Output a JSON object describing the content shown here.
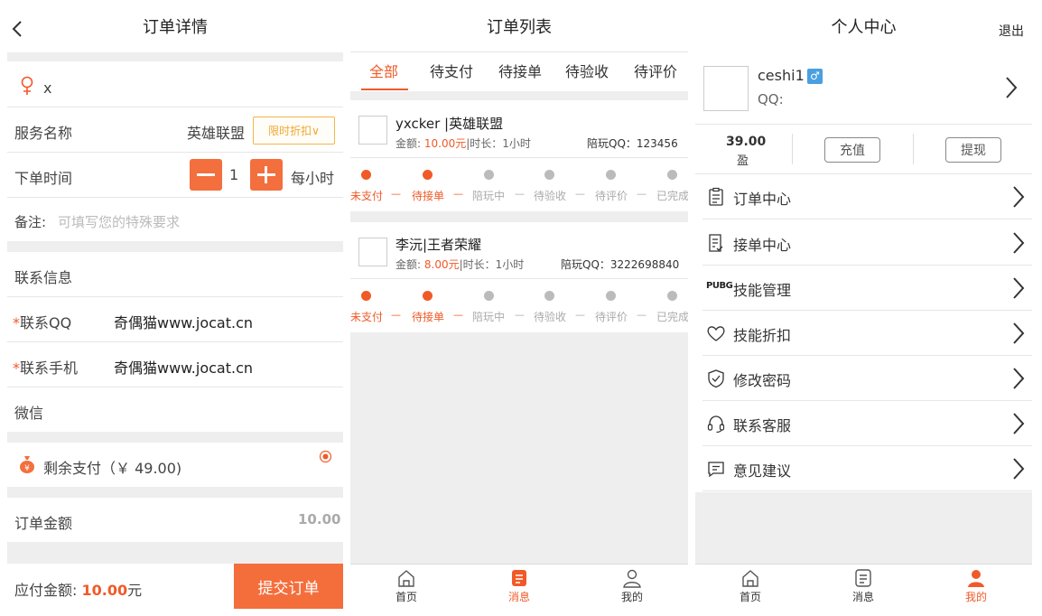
{
  "order_detail": {
    "title": "订单详情",
    "gender_name": "x",
    "service_label": "服务名称",
    "service_value": "英雄联盟",
    "promo_label": "限时折扣∨",
    "time_label": "下单时间",
    "quantity": "1",
    "unit": "每小时",
    "remark_label": "备注:",
    "remark_placeholder": "可填写您的特殊要求",
    "contact_title": "联系信息",
    "qq_label": "联系QQ",
    "qq_value": "奇偶猫www.jocat.cn",
    "phone_label": "联系手机",
    "phone_value": "奇偶猫www.jocat.cn",
    "wechat_label": "微信",
    "required_mark": "*",
    "pay_option": "剩余支付（￥ 49.00)",
    "amount_label": "订单金额",
    "amount_value": "10.00",
    "payable_label": "应付金额:",
    "payable_value": "10.00",
    "payable_unit": "元",
    "submit_label": "提交订单"
  },
  "order_list": {
    "title": "订单列表",
    "tabs": [
      "全部",
      "待支付",
      "待接单",
      "待验收",
      "待评价"
    ],
    "active_tab": "全部",
    "orders": [
      {
        "name": "yxcker |英雄联盟",
        "amount_label": "金额:",
        "amount": "10.00元",
        "duration": "|时长：1小时",
        "qq": "陪玩QQ：123456"
      },
      {
        "name": "李沅|王者荣耀",
        "amount_label": "金额:",
        "amount": "8.00元",
        "duration": "|时长：1小时",
        "qq": "陪玩QQ：3222698840"
      }
    ],
    "steps": [
      "未支付",
      "待接单",
      "陪玩中",
      "待验收",
      "待评价",
      "已完成"
    ],
    "steps_done": 2
  },
  "profile": {
    "title": "个人中心",
    "logout": "退出",
    "username": "ceshi1",
    "gender_symbol": "♂",
    "qq_label": "QQ:",
    "balance": "39.00",
    "balance_label": "盈",
    "recharge": "充值",
    "withdraw": "提现",
    "menu": [
      {
        "label": "订单中心",
        "icon": "clipboard-icon"
      },
      {
        "label": "接单中心",
        "icon": "checklist-icon"
      },
      {
        "label": "技能管理",
        "icon": "pubg-icon"
      },
      {
        "label": "技能折扣",
        "icon": "heart-icon"
      },
      {
        "label": "修改密码",
        "icon": "shield-check-icon"
      },
      {
        "label": "联系客服",
        "icon": "headset-icon"
      },
      {
        "label": "意见建议",
        "icon": "feedback-icon"
      }
    ],
    "pubg_text": "PUBG"
  },
  "nav": {
    "home": "首页",
    "messages": "消息",
    "mine": "我的"
  },
  "colors": {
    "accent": "#f05a28",
    "promo_border": "#f3b64b",
    "male_badge": "#4a9fe0",
    "separator": "#eeeeef"
  }
}
